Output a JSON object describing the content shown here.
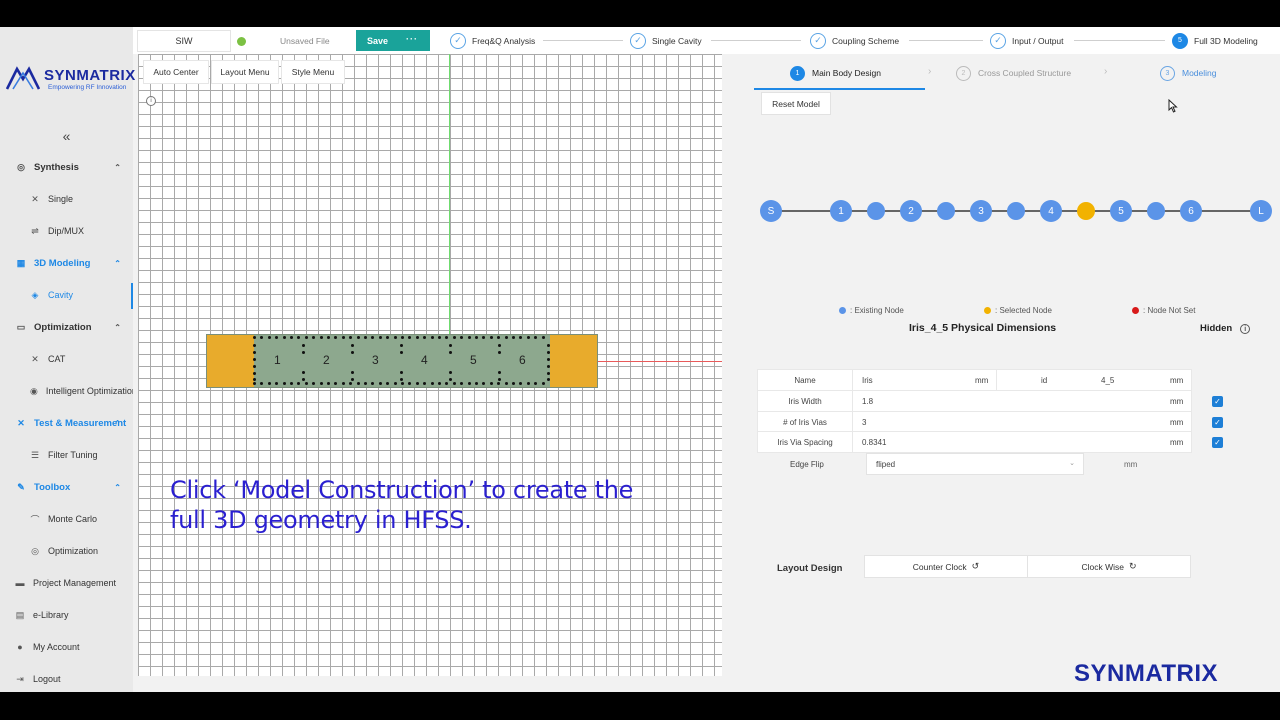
{
  "sidebar": {
    "logo": {
      "name": "SYNMATRIX",
      "tagline": "Empowering RF Innovation"
    },
    "collapse": "«",
    "items": [
      {
        "label": "Synthesis",
        "kind": "group",
        "icon": "chip-icon",
        "glyph": "◎",
        "chev": "⌃"
      },
      {
        "label": "Single",
        "kind": "sub",
        "icon": "filter-icon",
        "glyph": "✕"
      },
      {
        "label": "Dip/MUX",
        "kind": "sub",
        "icon": "split-icon",
        "glyph": "⇌"
      },
      {
        "label": "3D Modeling",
        "kind": "group",
        "icon": "cube-icon",
        "glyph": "▦",
        "chev": "⌃",
        "active": true
      },
      {
        "label": "Cavity",
        "kind": "sub",
        "icon": "cavity-icon",
        "glyph": "◈",
        "active": true
      },
      {
        "label": "Optimization",
        "kind": "group",
        "icon": "monitor-icon",
        "glyph": "▭",
        "chev": "⌃"
      },
      {
        "label": "CAT",
        "kind": "sub",
        "icon": "cat-icon",
        "glyph": "✕"
      },
      {
        "label": "Intelligent Optimization",
        "kind": "sub",
        "icon": "location-icon",
        "glyph": "◉"
      },
      {
        "label": "Test & Measurement",
        "kind": "group",
        "icon": "measure-icon",
        "glyph": "✕",
        "chev": "⌃",
        "active": true
      },
      {
        "label": "Filter Tuning",
        "kind": "sub",
        "icon": "sliders-icon",
        "glyph": "☰"
      },
      {
        "label": "Toolbox",
        "kind": "group",
        "icon": "wrench-icon",
        "glyph": "✎",
        "chev": "⌃",
        "active": true
      },
      {
        "label": "Monte Carlo",
        "kind": "sub",
        "icon": "dice-icon",
        "glyph": "⌒"
      },
      {
        "label": "Optimization",
        "kind": "sub",
        "icon": "target-icon",
        "glyph": "◎"
      },
      {
        "label": "Project Management",
        "kind": "top",
        "icon": "folder-icon",
        "glyph": "▬"
      },
      {
        "label": "e-Library",
        "kind": "top",
        "icon": "book-icon",
        "glyph": "▤"
      },
      {
        "label": "My Account",
        "kind": "top",
        "icon": "user-icon",
        "glyph": "●"
      },
      {
        "label": "Logout",
        "kind": "top",
        "icon": "logout-icon",
        "glyph": "⇥"
      }
    ]
  },
  "topbar": {
    "project": "SIW",
    "status": "Unsaved File",
    "save_label": "Save",
    "save_more": "···",
    "steps": [
      {
        "label": "Freq&Q Analysis",
        "mark": "✓"
      },
      {
        "label": "Single Cavity",
        "mark": "✓"
      },
      {
        "label": "Coupling Scheme",
        "mark": "✓"
      },
      {
        "label": "Input / Output",
        "mark": "✓"
      },
      {
        "label": "Full 3D Modeling",
        "mark": "5"
      }
    ]
  },
  "canvas": {
    "buttons": [
      "Auto Center",
      "Layout Menu",
      "Style Menu"
    ],
    "cavities": [
      "1",
      "2",
      "3",
      "4",
      "5",
      "6"
    ],
    "caption_line1": "Click ‘Model Construction’ to create the",
    "caption_line2": "full 3D geometry in HFSS."
  },
  "panel": {
    "tabs": [
      {
        "num": "1",
        "label": "Main Body Design"
      },
      {
        "num": "2",
        "label": "Cross Coupled Structure"
      },
      {
        "num": "3",
        "label": "Modeling"
      }
    ],
    "reset_label": "Reset Model",
    "nodes": [
      "S",
      "1",
      "",
      "2",
      "",
      "3",
      "",
      "4",
      "",
      "5",
      "",
      "6",
      "L"
    ],
    "selected_node_index": 8,
    "legend": [
      {
        "label": ": Existing Node",
        "color": "#5b94e8"
      },
      {
        "label": ": Selected Node",
        "color": "#f2b200"
      },
      {
        "label": ": Node Not Set",
        "color": "#d81a1a"
      }
    ],
    "dims_title": "Iris_4_5 Physical Dimensions",
    "hidden_label": "Hidden",
    "name_row": {
      "key": "Name",
      "value": "Iris",
      "unit": "mm",
      "key2": "id",
      "value2": "4_5",
      "unit2": "mm"
    },
    "rows": [
      {
        "key": "Iris Width",
        "value": "1.8",
        "unit": "mm"
      },
      {
        "key": "# of Iris Vias",
        "value": "3",
        "unit": "mm"
      },
      {
        "key": "Iris Via Spacing",
        "value": "0.8341",
        "unit": "mm"
      }
    ],
    "edge_flip": {
      "label": "Edge Flip",
      "value": "fliped",
      "unit": "mm"
    },
    "layout_design": {
      "label": "Layout Design",
      "ccw": "Counter Clock",
      "cw": "Clock Wise"
    },
    "brand": "SYNMATRIX"
  }
}
